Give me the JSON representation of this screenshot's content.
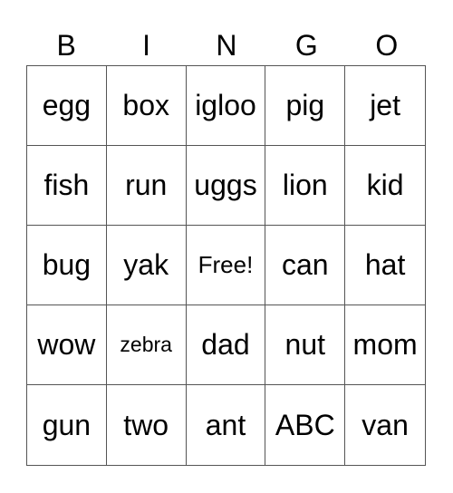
{
  "header": [
    "B",
    "I",
    "N",
    "G",
    "O"
  ],
  "cells": [
    "egg",
    "box",
    "igloo",
    "pig",
    "jet",
    "fish",
    "run",
    "uggs",
    "lion",
    "kid",
    "bug",
    "yak",
    "Free!",
    "can",
    "hat",
    "wow",
    "zebra",
    "dad",
    "nut",
    "mom",
    "gun",
    "two",
    "ant",
    "ABC",
    "van"
  ]
}
